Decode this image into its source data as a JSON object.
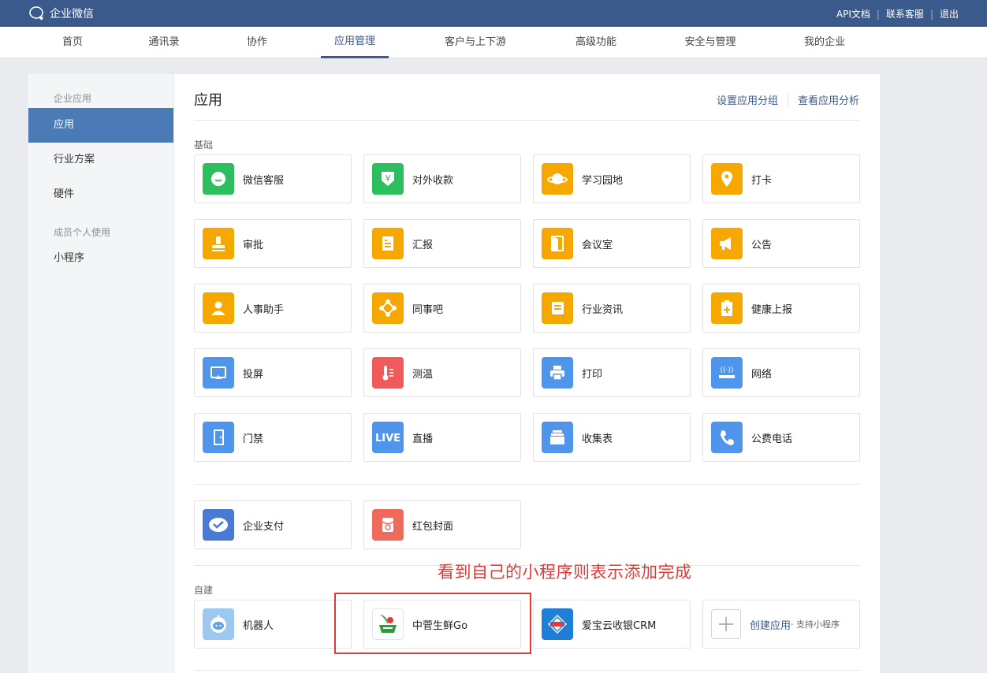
{
  "header": {
    "brand": "企业微信",
    "links": [
      "API文档",
      "联系客服",
      "退出"
    ]
  },
  "nav": {
    "items": [
      "首页",
      "通讯录",
      "协作",
      "应用管理",
      "客户与上下游",
      "高级功能",
      "安全与管理",
      "我的企业"
    ],
    "active_index": 3
  },
  "sidebar": {
    "group1": "企业应用",
    "items": [
      "应用",
      "行业方案",
      "硬件"
    ],
    "group2": "成员个人使用",
    "item_mini": "小程序"
  },
  "main": {
    "title": "应用",
    "actions": [
      "设置应用分组",
      "查看应用分析"
    ],
    "section_basic": "基础",
    "section_custom": "自建",
    "basic_apps": [
      {
        "label": "微信客服",
        "icon": "wechat-service-icon",
        "color": "#2dbe60"
      },
      {
        "label": "对外收款",
        "icon": "payment-shield-icon",
        "color": "#2dbe60"
      },
      {
        "label": "学习园地",
        "icon": "planet-icon",
        "color": "#f7a800"
      },
      {
        "label": "打卡",
        "icon": "location-pin-icon",
        "color": "#f7a800"
      },
      {
        "label": "审批",
        "icon": "stamp-icon",
        "color": "#f7a800"
      },
      {
        "label": "汇报",
        "icon": "report-doc-icon",
        "color": "#f7a800"
      },
      {
        "label": "会议室",
        "icon": "door-icon",
        "color": "#f7a800"
      },
      {
        "label": "公告",
        "icon": "megaphone-icon",
        "color": "#f7a800"
      },
      {
        "label": "人事助手",
        "icon": "person-icon",
        "color": "#f7a800"
      },
      {
        "label": "同事吧",
        "icon": "network-icon",
        "color": "#f7a800"
      },
      {
        "label": "行业资讯",
        "icon": "news-icon",
        "color": "#f7a800"
      },
      {
        "label": "健康上报",
        "icon": "health-clipboard-icon",
        "color": "#f7a800"
      },
      {
        "label": "投屏",
        "icon": "screen-cast-icon",
        "color": "#4f95ec"
      },
      {
        "label": "测温",
        "icon": "thermometer-icon",
        "color": "#f05a5a"
      },
      {
        "label": "打印",
        "icon": "printer-icon",
        "color": "#4f95ec"
      },
      {
        "label": "网络",
        "icon": "router-icon",
        "color": "#4f95ec"
      },
      {
        "label": "门禁",
        "icon": "access-door-icon",
        "color": "#4f95ec"
      },
      {
        "label": "直播",
        "icon": "live-icon",
        "color": "#4f95ec"
      },
      {
        "label": "收集表",
        "icon": "form-stack-icon",
        "color": "#4f95ec"
      },
      {
        "label": "公费电话",
        "icon": "phone-icon",
        "color": "#4f95ec"
      }
    ],
    "extra_apps": [
      {
        "label": "企业支付",
        "icon": "enterprise-pay-icon",
        "color": "#4a7bd4"
      },
      {
        "label": "红包封面",
        "icon": "red-envelope-icon",
        "color": "#ef6a5a"
      }
    ],
    "custom_apps": [
      {
        "label": "机器人",
        "icon": "robot-icon",
        "color": "#9cc8f2"
      },
      {
        "label": "中菅生鲜Go",
        "icon": "fresh-go-logo-icon",
        "color": "#ffffff"
      },
      {
        "label": "爱宝云收银CRM",
        "icon": "aibao-logo-icon",
        "color": "#1f7fd6"
      }
    ],
    "create_app": {
      "label": "创建应用",
      "sub": "· 支持小程序"
    }
  },
  "annotation": {
    "note": "看到自己的小程序则表示添加完成",
    "color": "#e53935"
  }
}
